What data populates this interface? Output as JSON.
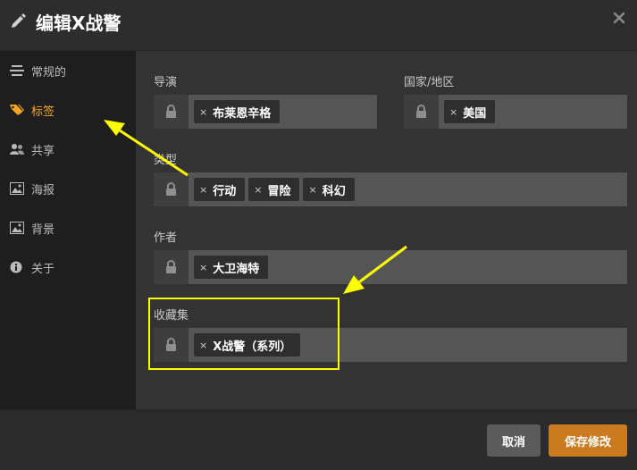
{
  "header": {
    "title": "编辑X战警",
    "edit_icon": "pencil-icon",
    "close_icon": "close-icon"
  },
  "sidebar": {
    "items": [
      {
        "label": "常规的",
        "icon": "list-icon",
        "active": false
      },
      {
        "label": "标签",
        "icon": "tag-icon",
        "active": true
      },
      {
        "label": "共享",
        "icon": "users-icon",
        "active": false
      },
      {
        "label": "海报",
        "icon": "image-icon",
        "active": false
      },
      {
        "label": "背景",
        "icon": "image-icon",
        "active": false
      },
      {
        "label": "关于",
        "icon": "info-icon",
        "active": false
      }
    ]
  },
  "fields": {
    "director": {
      "label": "导演",
      "tags": [
        "布莱恩辛格"
      ]
    },
    "country": {
      "label": "国家/地区",
      "tags": [
        "美国"
      ]
    },
    "genre": {
      "label": "类型",
      "tags": [
        "行动",
        "冒险",
        "科幻"
      ]
    },
    "writer": {
      "label": "作者",
      "tags": [
        "大卫海特"
      ]
    },
    "collection": {
      "label": "收藏集",
      "tags": [
        "X战警（系列）"
      ]
    }
  },
  "tag_remove_glyph": "×",
  "footer": {
    "cancel_label": "取消",
    "save_label": "保存修改"
  },
  "colors": {
    "accent": "#f5a623",
    "save_button": "#cc7a1f",
    "annotation": "#ffff00"
  }
}
